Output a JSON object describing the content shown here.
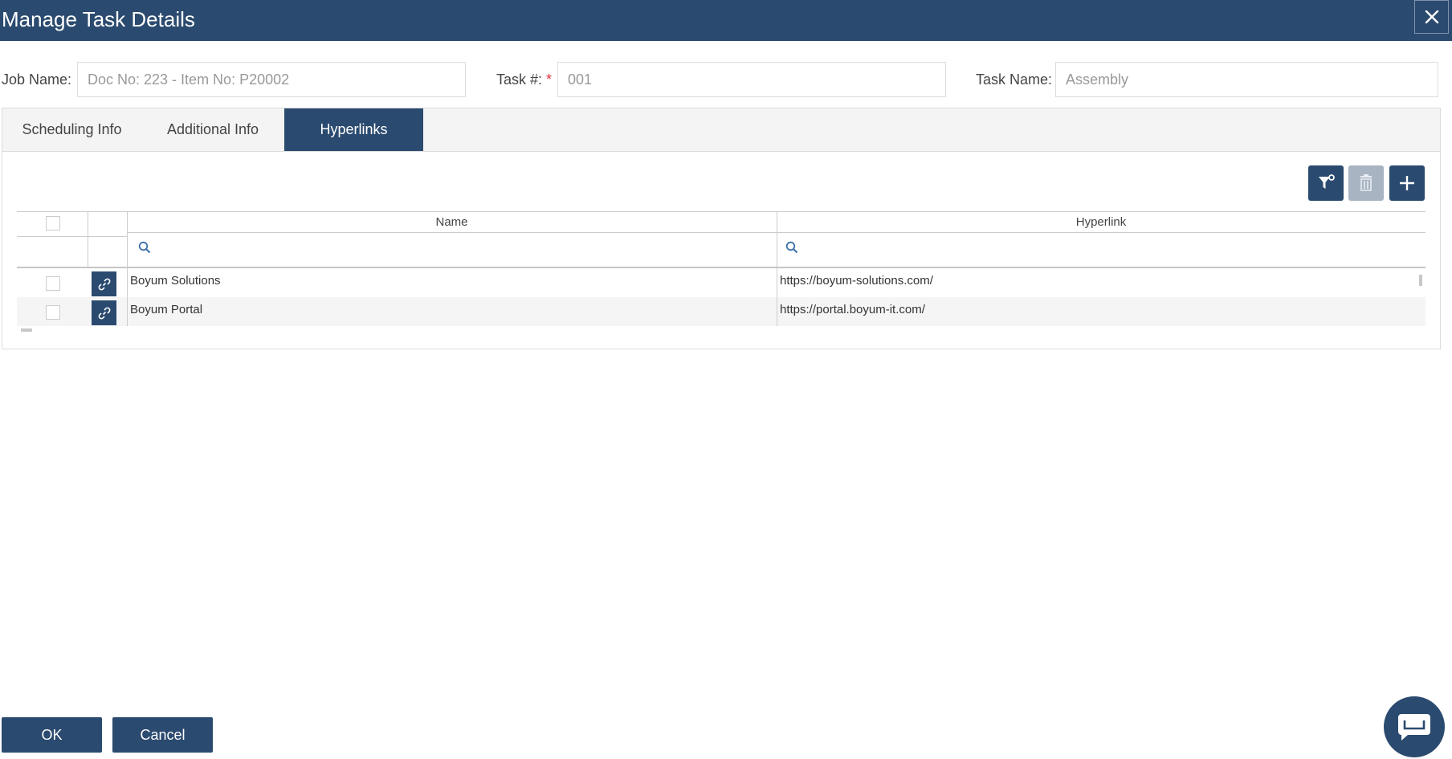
{
  "header": {
    "title": "Manage Task Details",
    "close_icon": "close-icon"
  },
  "fields": {
    "job_name_label": "Job Name:",
    "job_name_value": "Doc No: 223 - Item No: P20002",
    "task_num_label": "Task #:",
    "task_num_required": "*",
    "task_num_value": "001",
    "task_name_label": "Task Name:",
    "task_name_value": "Assembly"
  },
  "tabs": [
    {
      "label": "Scheduling Info",
      "active": false
    },
    {
      "label": "Additional Info",
      "active": false
    },
    {
      "label": "Hyperlinks",
      "active": true
    }
  ],
  "toolbar": {
    "filter_icon": "filter-clear-icon",
    "delete_icon": "trash-icon",
    "add_icon": "plus-icon"
  },
  "grid": {
    "columns": [
      "Name",
      "Hyperlink"
    ],
    "rows": [
      {
        "name": "Boyum Solutions",
        "hyperlink": "https://boyum-solutions.com/"
      },
      {
        "name": "Boyum Portal",
        "hyperlink": "https://portal.boyum-it.com/"
      }
    ],
    "row_icon": "link-icon",
    "search_icon": "search-icon"
  },
  "footer": {
    "ok_label": "OK",
    "cancel_label": "Cancel"
  },
  "chat": {
    "icon": "chat-bubble-icon"
  },
  "colors": {
    "primary": "#2b4a6f",
    "disabled": "#a8b4c2",
    "required": "#d9303b"
  }
}
